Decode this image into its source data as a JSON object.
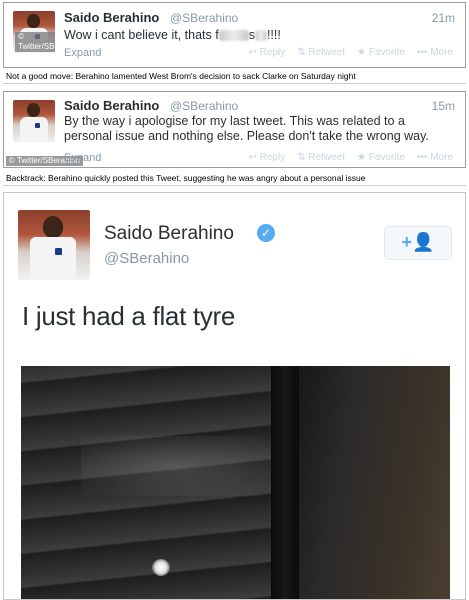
{
  "tweet1": {
    "name": "Saido Berahino",
    "handle": "@SBerahino",
    "time": "21m",
    "text_before": "Wow i cant believe it, thats f",
    "text_middle": "s",
    "text_after": "!!!!",
    "expand": "Expand",
    "actions": {
      "reply": "↩ Reply",
      "retweet": "⇅ Retweet",
      "favorite": "★ Favorite",
      "more": "••• More"
    },
    "watermark": "© Twitter/SBerahino"
  },
  "caption1": "Not a good move: Berahino lamented West Brom's decision to sack Clarke on Saturday night",
  "tweet2": {
    "name": "Saido Berahino",
    "handle": "@SBerahino",
    "time": "15m",
    "text": "By the way i apologise for my last tweet. This was related to a personal issue and nothing else. Please don't take the wrong way.",
    "expand": "Expand",
    "actions": {
      "reply": "↩ Reply",
      "retweet": "⇅ Retweet",
      "favorite": "★ Favorite",
      "more": "••• More"
    },
    "watermark": "© Twitter/SBerahino"
  },
  "caption2": "Backtrack: Berahino quickly posted this Tweet, suggesting he was angry about a personal issue",
  "tweet3": {
    "name": "Saido Berahino",
    "handle": "@SBerahino",
    "text": "I just had a flat tyre",
    "follow_icon": "+👤"
  },
  "colors": {
    "twitter_blue": "#55acee",
    "text": "#292f33",
    "muted": "#8899a6"
  }
}
